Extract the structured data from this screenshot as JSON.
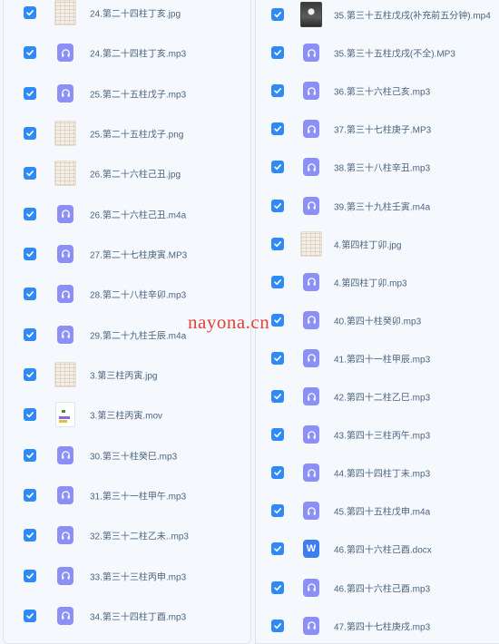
{
  "left_files": [
    {
      "name": "24.第二十四柱丁亥.jpg",
      "kind": "image",
      "checked": true
    },
    {
      "name": "24.第二十四柱丁亥.mp3",
      "kind": "audio",
      "checked": true
    },
    {
      "name": "25.第二十五柱戊子.mp3",
      "kind": "audio",
      "checked": true
    },
    {
      "name": "25.第二十五柱戊子.png",
      "kind": "image",
      "checked": true
    },
    {
      "name": "26.第二十六柱己丑.jpg",
      "kind": "image",
      "checked": true
    },
    {
      "name": "26.第二十六柱己丑.m4a",
      "kind": "audio",
      "checked": true
    },
    {
      "name": "27.第二十七柱庚寅.MP3",
      "kind": "audio",
      "checked": true
    },
    {
      "name": "28.第二十八柱辛卯.mp3",
      "kind": "audio",
      "checked": true
    },
    {
      "name": "29.第二十九柱壬辰.m4a",
      "kind": "audio",
      "checked": true
    },
    {
      "name": "3.第三柱丙寅.jpg",
      "kind": "image",
      "checked": true
    },
    {
      "name": "3.第三柱丙寅.mov",
      "kind": "video",
      "checked": true
    },
    {
      "name": "30.第三十柱癸巳.mp3",
      "kind": "audio",
      "checked": true
    },
    {
      "name": "31.第三十一柱甲午.mp3",
      "kind": "audio",
      "checked": true
    },
    {
      "name": "32.第三十二柱乙未..mp3",
      "kind": "audio",
      "checked": true
    },
    {
      "name": "33.第三十三柱丙申.mp3",
      "kind": "audio",
      "checked": true
    },
    {
      "name": "34.第三十四柱丁酉.mp3",
      "kind": "audio",
      "checked": true
    }
  ],
  "right_files": [
    {
      "name": "35.第三十五柱戊戌(补充前五分钟).mp4",
      "kind": "image-dark",
      "checked": true
    },
    {
      "name": "35.第三十五柱戊戌(不全).MP3",
      "kind": "audio",
      "checked": true
    },
    {
      "name": "36.第三十六柱己亥.mp3",
      "kind": "audio",
      "checked": true
    },
    {
      "name": "37.第三十七柱庚子.MP3",
      "kind": "audio",
      "checked": true
    },
    {
      "name": "38.第三十八柱辛丑.mp3",
      "kind": "audio",
      "checked": true
    },
    {
      "name": "39.第三十九柱壬寅.m4a",
      "kind": "audio",
      "checked": true
    },
    {
      "name": "4.第四柱丁卯.jpg",
      "kind": "image",
      "checked": true
    },
    {
      "name": "4.第四柱丁卯.mp3",
      "kind": "audio",
      "checked": true
    },
    {
      "name": "40.第四十柱癸卯.mp3",
      "kind": "audio",
      "checked": true
    },
    {
      "name": "41.第四十一柱甲辰.mp3",
      "kind": "audio",
      "checked": true
    },
    {
      "name": "42.第四十二柱乙巳.mp3",
      "kind": "audio",
      "checked": true
    },
    {
      "name": "43.第四十三柱丙午.mp3",
      "kind": "audio",
      "checked": true
    },
    {
      "name": "44.第四十四柱丁未.mp3",
      "kind": "audio",
      "checked": true
    },
    {
      "name": "45.第四十五柱戊申.m4a",
      "kind": "audio",
      "checked": true
    },
    {
      "name": "46.第四十六柱己酉.docx",
      "kind": "word",
      "checked": true
    },
    {
      "name": "46.第四十六柱己酉.mp3",
      "kind": "audio",
      "checked": true
    },
    {
      "name": "47.第四十七柱庚戌.mp3",
      "kind": "audio",
      "checked": true
    }
  ],
  "word_icon_letter": "W",
  "watermark": "nayona.cn",
  "colors": {
    "accent": "#2f8af5",
    "audio_icon": "#8c8ff5",
    "word_icon": "#3d7df0",
    "filename_text": "#4c6381",
    "watermark": "#e0423c"
  }
}
